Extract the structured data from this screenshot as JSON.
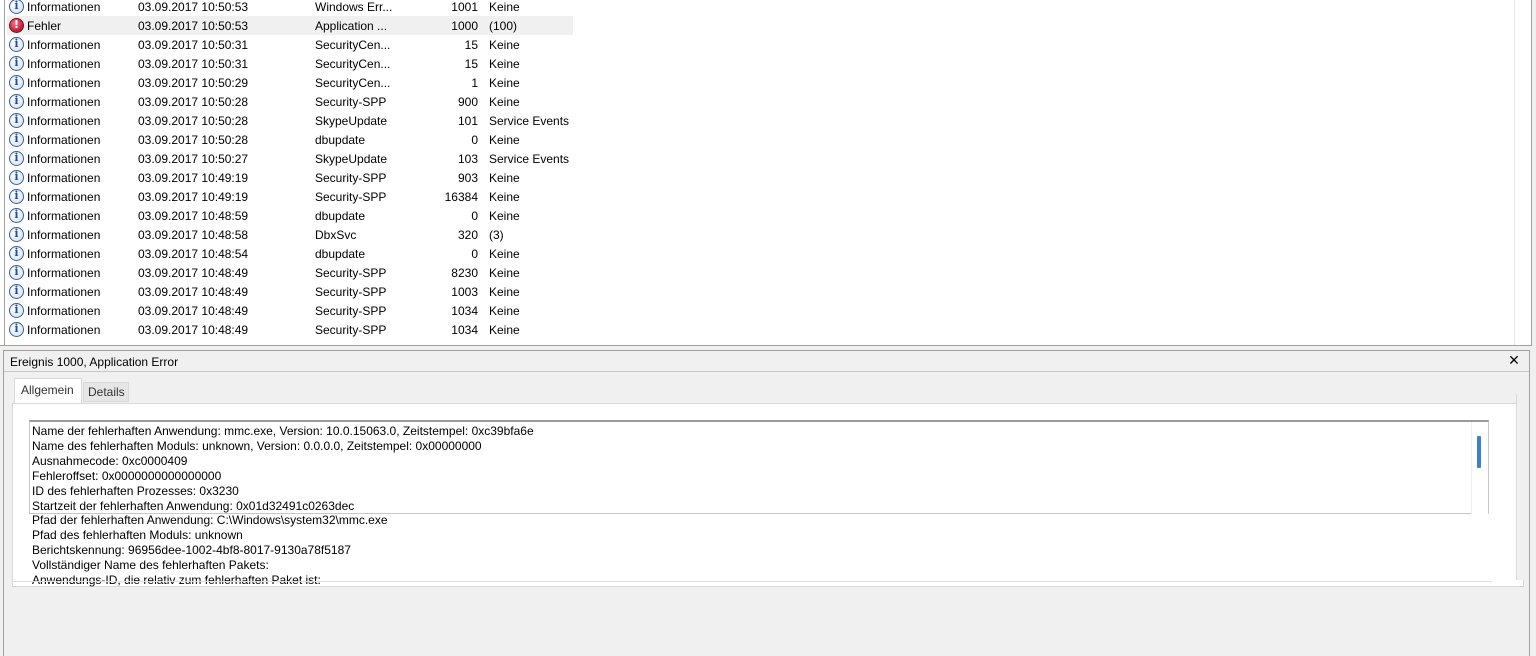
{
  "event_list": {
    "rows": [
      {
        "level": "Informationen",
        "icon": "info-icon",
        "date": "03.09.2017 10:50:53",
        "source": "Windows Err...",
        "id": "1001",
        "category": "Keine"
      },
      {
        "level": "Fehler",
        "icon": "error-icon",
        "date": "03.09.2017 10:50:53",
        "source": "Application ...",
        "id": "1000",
        "category": "(100)",
        "selected": true
      },
      {
        "level": "Informationen",
        "icon": "info-icon",
        "date": "03.09.2017 10:50:31",
        "source": "SecurityCen...",
        "id": "15",
        "category": "Keine"
      },
      {
        "level": "Informationen",
        "icon": "info-icon",
        "date": "03.09.2017 10:50:31",
        "source": "SecurityCen...",
        "id": "15",
        "category": "Keine"
      },
      {
        "level": "Informationen",
        "icon": "info-icon",
        "date": "03.09.2017 10:50:29",
        "source": "SecurityCen...",
        "id": "1",
        "category": "Keine"
      },
      {
        "level": "Informationen",
        "icon": "info-icon",
        "date": "03.09.2017 10:50:28",
        "source": "Security-SPP",
        "id": "900",
        "category": "Keine"
      },
      {
        "level": "Informationen",
        "icon": "info-icon",
        "date": "03.09.2017 10:50:28",
        "source": "SkypeUpdate",
        "id": "101",
        "category": "Service Events"
      },
      {
        "level": "Informationen",
        "icon": "info-icon",
        "date": "03.09.2017 10:50:28",
        "source": "dbupdate",
        "id": "0",
        "category": "Keine"
      },
      {
        "level": "Informationen",
        "icon": "info-icon",
        "date": "03.09.2017 10:50:27",
        "source": "SkypeUpdate",
        "id": "103",
        "category": "Service Events"
      },
      {
        "level": "Informationen",
        "icon": "info-icon",
        "date": "03.09.2017 10:49:19",
        "source": "Security-SPP",
        "id": "903",
        "category": "Keine"
      },
      {
        "level": "Informationen",
        "icon": "info-icon",
        "date": "03.09.2017 10:49:19",
        "source": "Security-SPP",
        "id": "16384",
        "category": "Keine"
      },
      {
        "level": "Informationen",
        "icon": "info-icon",
        "date": "03.09.2017 10:48:59",
        "source": "dbupdate",
        "id": "0",
        "category": "Keine"
      },
      {
        "level": "Informationen",
        "icon": "info-icon",
        "date": "03.09.2017 10:48:58",
        "source": "DbxSvc",
        "id": "320",
        "category": "(3)"
      },
      {
        "level": "Informationen",
        "icon": "info-icon",
        "date": "03.09.2017 10:48:54",
        "source": "dbupdate",
        "id": "0",
        "category": "Keine"
      },
      {
        "level": "Informationen",
        "icon": "info-icon",
        "date": "03.09.2017 10:48:49",
        "source": "Security-SPP",
        "id": "8230",
        "category": "Keine"
      },
      {
        "level": "Informationen",
        "icon": "info-icon",
        "date": "03.09.2017 10:48:49",
        "source": "Security-SPP",
        "id": "1003",
        "category": "Keine"
      },
      {
        "level": "Informationen",
        "icon": "info-icon",
        "date": "03.09.2017 10:48:49",
        "source": "Security-SPP",
        "id": "1034",
        "category": "Keine"
      },
      {
        "level": "Informationen",
        "icon": "info-icon",
        "date": "03.09.2017 10:48:49",
        "source": "Security-SPP",
        "id": "1034",
        "category": "Keine"
      }
    ]
  },
  "detail": {
    "title": "Ereignis 1000, Application Error",
    "close_icon": "close-icon",
    "tabs": [
      {
        "label": "Allgemein",
        "active": true
      },
      {
        "label": "Details",
        "active": false
      }
    ],
    "lines": [
      "Name der fehlerhaften Anwendung: mmc.exe, Version: 10.0.15063.0, Zeitstempel: 0xc39bfa6e",
      "Name des fehlerhaften Moduls: unknown, Version: 0.0.0.0, Zeitstempel: 0x00000000",
      "Ausnahmecode: 0xc0000409",
      "Fehleroffset: 0x0000000000000000",
      "ID des fehlerhaften Prozesses: 0x3230",
      "Startzeit der fehlerhaften Anwendung: 0x01d32491c0263dec",
      "Pfad der fehlerhaften Anwendung: C:\\Windows\\system32\\mmc.exe",
      "Pfad des fehlerhaften Moduls: unknown",
      "Berichtskennung: 96956dee-1002-4bf8-8017-9130a78f5187",
      "Vollständiger Name des fehlerhaften Pakets:",
      "Anwendungs-ID, die relativ zum fehlerhaften Paket ist:"
    ]
  },
  "colors": {
    "selection": "#f0f0f0",
    "window_bg": "#f0f0f0",
    "scroll_thumb": "#3c7fd2"
  }
}
